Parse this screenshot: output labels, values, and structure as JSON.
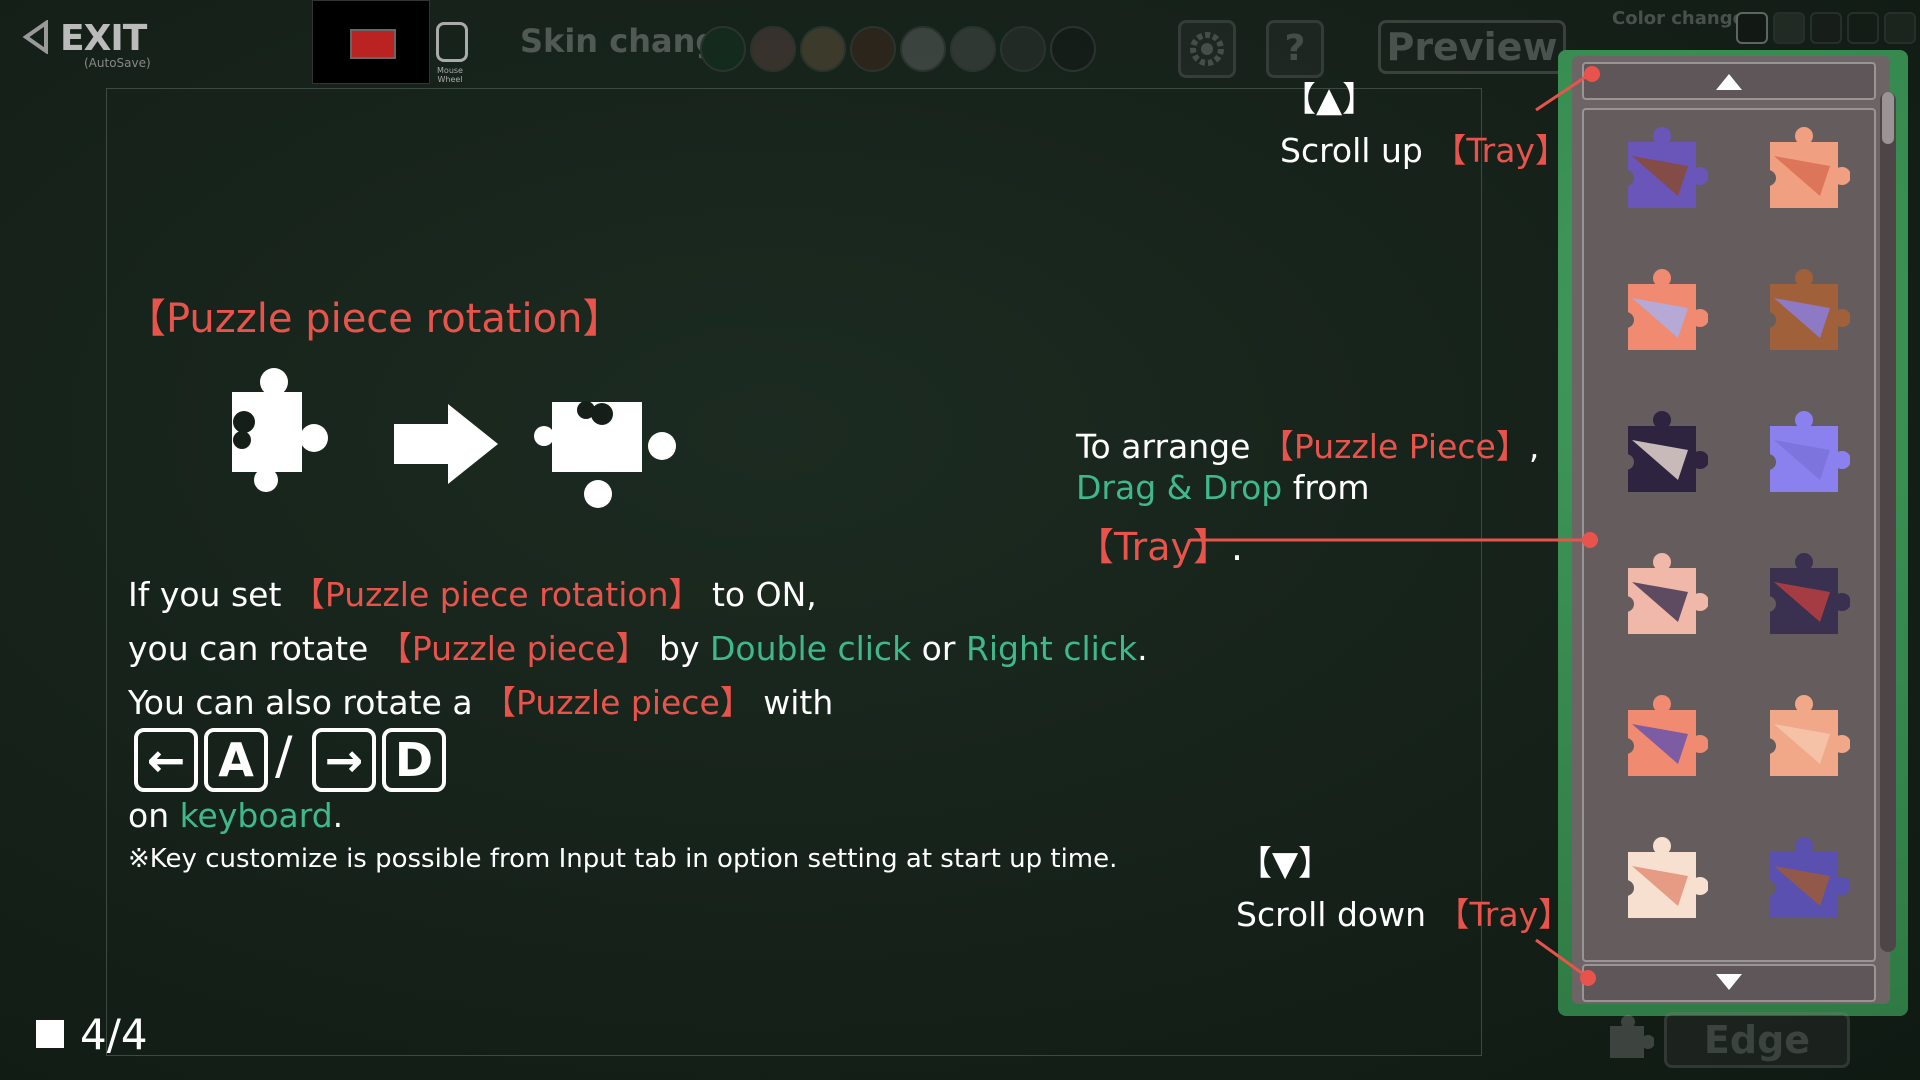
{
  "topbar": {
    "exit_label": "EXIT",
    "exit_sub": "(AutoSave)",
    "mouse_wheel_label": "Mouse Wheel",
    "skin_label": "Skin change",
    "skins": [
      "#0d3b20",
      "#7a5050",
      "#8a6a4a",
      "#5a2a20",
      "#888888",
      "#666666",
      "#3a3a3a",
      "#111111"
    ],
    "help_label": "?",
    "preview_label": "Preview",
    "color_label": "Color change",
    "colors": [
      "#111111",
      "#444444",
      "#222222",
      "#1a1a1a",
      "#333333"
    ]
  },
  "help": {
    "title": "【Puzzle piece rotation】",
    "line1": {
      "a": "If you set ",
      "b": "【Puzzle piece rotation】",
      "c": " to ON,"
    },
    "line2": {
      "a": "you can rotate ",
      "b": "【Puzzle piece】",
      "c": " by ",
      "d": "Double click",
      "e": " or ",
      "f": "Right click",
      "g": "."
    },
    "line3": {
      "a": "You can also rotate a ",
      "b": "【Puzzle piece】",
      "c": " with"
    },
    "keys": [
      "←",
      "A",
      "→",
      "D"
    ],
    "slash": "/",
    "line4": {
      "a": "on ",
      "b": "keyboard",
      "c": "."
    },
    "note": "※Key customize is possible from Input tab in option setting at start up time."
  },
  "annotations": {
    "up_marker": "【▲】",
    "up_text": {
      "a": "Scroll up ",
      "b": "【Tray】",
      "c": "."
    },
    "arrange": {
      "a": "To arrange ",
      "b": "【Puzzle Piece】",
      "c": ",",
      "d": "Drag & Drop",
      "e": " from",
      "f": "【Tray】",
      "g": "."
    },
    "down_marker": "【▼】",
    "down_text": {
      "a": "Scroll down ",
      "b": "【Tray】",
      "c": "."
    }
  },
  "tray": {
    "pieces": [
      {
        "name": "piece-1",
        "color": "#6a55b8",
        "accent": "#8a4a2a"
      },
      {
        "name": "piece-2",
        "color": "#f0a080",
        "accent": "#d86a50"
      },
      {
        "name": "piece-3",
        "color": "#f08a70",
        "accent": "#a8b0f0"
      },
      {
        "name": "piece-4",
        "color": "#a0603a",
        "accent": "#8a80e8"
      },
      {
        "name": "piece-5",
        "color": "#2e2440",
        "accent": "#f0e0d8"
      },
      {
        "name": "piece-6",
        "color": "#8a80ee",
        "accent": "#7a70d8"
      },
      {
        "name": "piece-7",
        "color": "#f0b8a8",
        "accent": "#3a3050"
      },
      {
        "name": "piece-8",
        "color": "#3a3050",
        "accent": "#c04040"
      },
      {
        "name": "piece-9",
        "color": "#f08a70",
        "accent": "#6050b0"
      },
      {
        "name": "piece-10",
        "color": "#f0a888",
        "accent": "#f6c8b0"
      },
      {
        "name": "piece-11",
        "color": "#f8e0d0",
        "accent": "#e08a70"
      },
      {
        "name": "piece-12",
        "color": "#5a50b0",
        "accent": "#a05a30"
      }
    ]
  },
  "edge_label": "Edge",
  "page": "4/4"
}
